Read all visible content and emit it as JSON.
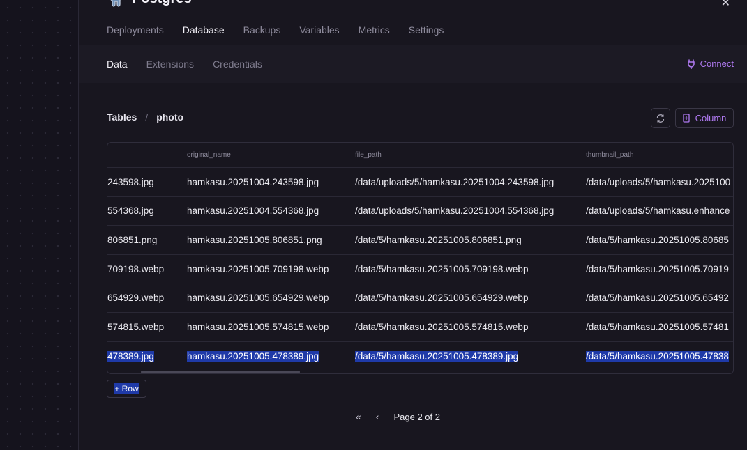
{
  "service": {
    "title": "Postgres",
    "icon": "elephant-icon"
  },
  "close_glyph": "✕",
  "main_tabs": [
    {
      "label": "Deployments",
      "active": false
    },
    {
      "label": "Database",
      "active": true
    },
    {
      "label": "Backups",
      "active": false
    },
    {
      "label": "Variables",
      "active": false
    },
    {
      "label": "Metrics",
      "active": false
    },
    {
      "label": "Settings",
      "active": false
    }
  ],
  "sub_tabs": [
    {
      "label": "Data",
      "active": true
    },
    {
      "label": "Extensions",
      "active": false
    },
    {
      "label": "Credentials",
      "active": false
    }
  ],
  "connect_label": "Connect",
  "breadcrumb": {
    "root": "Tables",
    "separator": "/",
    "current": "photo"
  },
  "toolbar": {
    "column_label": "Column"
  },
  "table": {
    "headers": [
      "",
      "original_name",
      "file_path",
      "thumbnail_path"
    ],
    "rows": [
      [
        "243598.jpg",
        "hamkasu.20251004.243598.jpg",
        "/data/uploads/5/hamkasu.20251004.243598.jpg",
        "/data/uploads/5/hamkasu.2025100"
      ],
      [
        "554368.jpg",
        "hamkasu.20251004.554368.jpg",
        "/data/uploads/5/hamkasu.20251004.554368.jpg",
        "/data/uploads/5/hamkasu.enhance"
      ],
      [
        "806851.png",
        "hamkasu.20251005.806851.png",
        "/data/5/hamkasu.20251005.806851.png",
        "/data/5/hamkasu.20251005.80685"
      ],
      [
        "709198.webp",
        "hamkasu.20251005.709198.webp",
        "/data/5/hamkasu.20251005.709198.webp",
        "/data/5/hamkasu.20251005.70919"
      ],
      [
        "654929.webp",
        "hamkasu.20251005.654929.webp",
        "/data/5/hamkasu.20251005.654929.webp",
        "/data/5/hamkasu.20251005.65492"
      ],
      [
        "574815.webp",
        "hamkasu.20251005.574815.webp",
        "/data/5/hamkasu.20251005.574815.webp",
        "/data/5/hamkasu.20251005.57481"
      ],
      [
        "478389.jpg",
        "hamkasu.20251005.478389.jpg",
        "/data/5/hamkasu.20251005.478389.jpg",
        "/data/5/hamkasu.20251005.47838"
      ]
    ],
    "selected_row": 6
  },
  "add_row_label": "+ Row",
  "pager": {
    "first_glyph": "«",
    "prev_glyph": "‹",
    "label": "Page 2 of 2"
  },
  "colors": {
    "accent": "#b07af2",
    "selection": "#1f3aa8",
    "background": "#18161f"
  }
}
